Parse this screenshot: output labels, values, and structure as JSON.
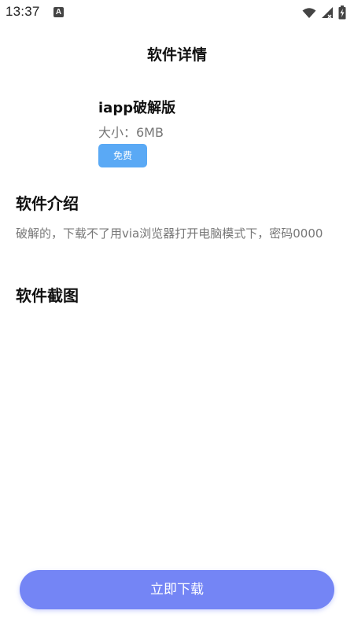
{
  "status_bar": {
    "time": "13:37",
    "notification_icon": "a-letter-icon",
    "right_icons": [
      "wifi-icon",
      "signal-icon",
      "battery-charging-icon"
    ]
  },
  "header": {
    "title": "软件详情"
  },
  "app": {
    "name": "iapp破解版",
    "size": "大小：6MB",
    "price_badge": "免费"
  },
  "intro": {
    "title": "软件介绍",
    "text": "破解的，下载不了用via浏览器打开电脑模式下，密码0000"
  },
  "screenshots": {
    "title": "软件截图"
  },
  "actions": {
    "download_label": "立即下载"
  },
  "colors": {
    "badge": "#5aa9f5",
    "download_button": "#7485f5",
    "secondary_text": "#777777"
  }
}
